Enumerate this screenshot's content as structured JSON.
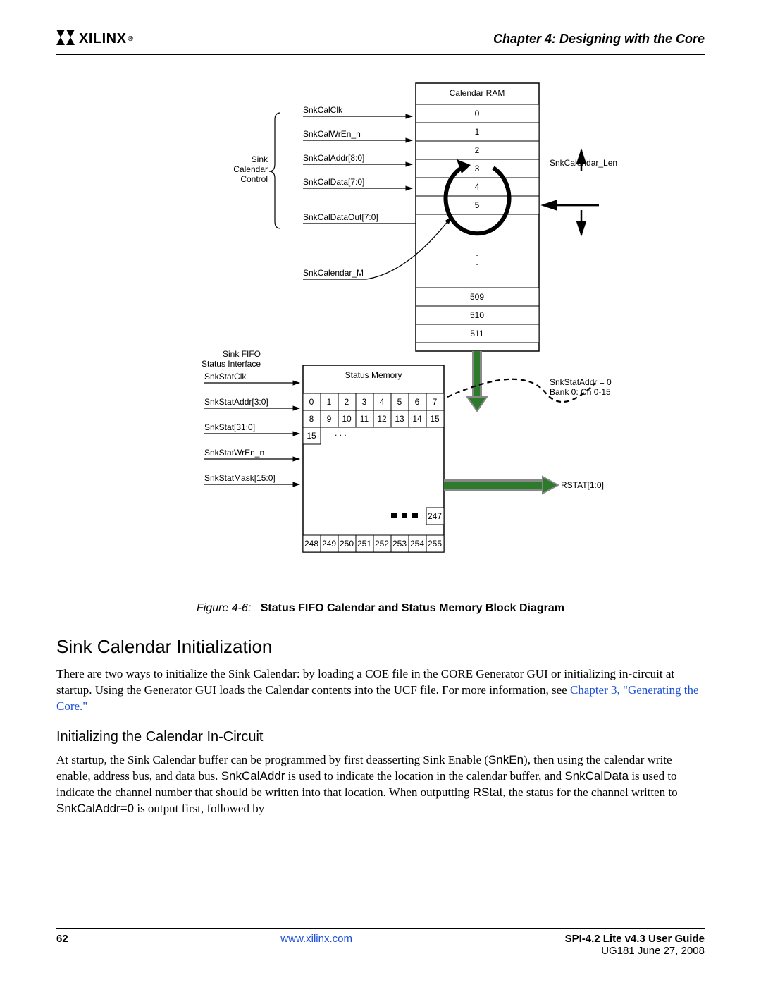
{
  "header": {
    "company": "XILINX",
    "chapter_prefix": "Chapter 4:",
    "chapter_title": "Designing with the Core"
  },
  "diagram": {
    "sink_control_label_l1": "Sink",
    "sink_control_label_l2": "Calendar",
    "sink_control_label_l3": "Control",
    "signals_top": [
      "SnkCalClk",
      "SnkCalWrEn_n",
      "SnkCalAddr[8:0]",
      "SnkCalData[7:0]",
      "SnkCalDataOut[7:0]"
    ],
    "snk_calendar_m": "SnkCalendar_M",
    "calendar_ram_title": "Calendar RAM",
    "ram_top_rows": [
      "0",
      "1",
      "2",
      "3",
      "4",
      "5"
    ],
    "ram_bottom_rows": [
      "509",
      "510",
      "511"
    ],
    "snk_calendar_len": "SnkCalendar_Len",
    "sink_fifo_l1": "Sink FIFO",
    "sink_fifo_l2": "Status Interface",
    "signals_bottom": [
      "SnkStatClk",
      "SnkStatAddr[3:0]",
      "SnkStat[31:0]",
      "SnkStatWrEn_n",
      "SnkStatMask[15:0]"
    ],
    "status_memory_title": "Status Memory",
    "status_row1": [
      "0",
      "1",
      "2",
      "3",
      "4",
      "5",
      "6",
      "7"
    ],
    "status_row2": [
      "8",
      "9",
      "10",
      "11",
      "12",
      "13",
      "14",
      "15"
    ],
    "status_row3_first": "15",
    "status_last_row_pre": "247",
    "status_last_row": [
      "248",
      "249",
      "250",
      "251",
      "252",
      "253",
      "254",
      "255"
    ],
    "snkstat_addr_l1": "SnkStatAddr = 0",
    "snkstat_addr_l2": "Bank 0: Ch 0-15",
    "rstat": "RSTAT[1:0]"
  },
  "figure_caption": {
    "label": "Figure 4-6:",
    "title": "Status FIFO Calendar and Status Memory Block Diagram"
  },
  "section_heading": "Sink Calendar Initialization",
  "para1_a": "There are two ways to initialize the Sink Calendar: by loading a COE file in the CORE Generator GUI or initializing in-circuit at startup. Using the Generator GUI loads the Calendar contents into the UCF file. For more information, see ",
  "para1_link": "Chapter 3, \"Generating the Core.\"",
  "subsection_heading": "Initializing the Calendar In-Circuit",
  "para2_a": "At startup, the Sink Calendar buffer can be programmed by first deasserting Sink Enable (",
  "para2_snken": "SnkEn",
  "para2_b": "), then using the calendar write enable, address bus, and data bus. ",
  "para2_snkcaladdr": "SnkCalAddr",
  "para2_c": " is used to indicate the location in the calendar buffer, and ",
  "para2_snkcaldata": "SnkCalData",
  "para2_d": " is used to indicate the channel number that should be written into that location. When outputting ",
  "para2_rstat": "RStat",
  "para2_e": ", the status for the channel written to ",
  "para2_snkcaladdr0": "SnkCalAddr=0",
  "para2_f": " is output first, followed by",
  "footer": {
    "page_number": "62",
    "url": "www.xilinx.com",
    "doc_title": "SPI-4.2 Lite v4.3 User Guide",
    "doc_id": "UG181 June 27, 2008"
  }
}
